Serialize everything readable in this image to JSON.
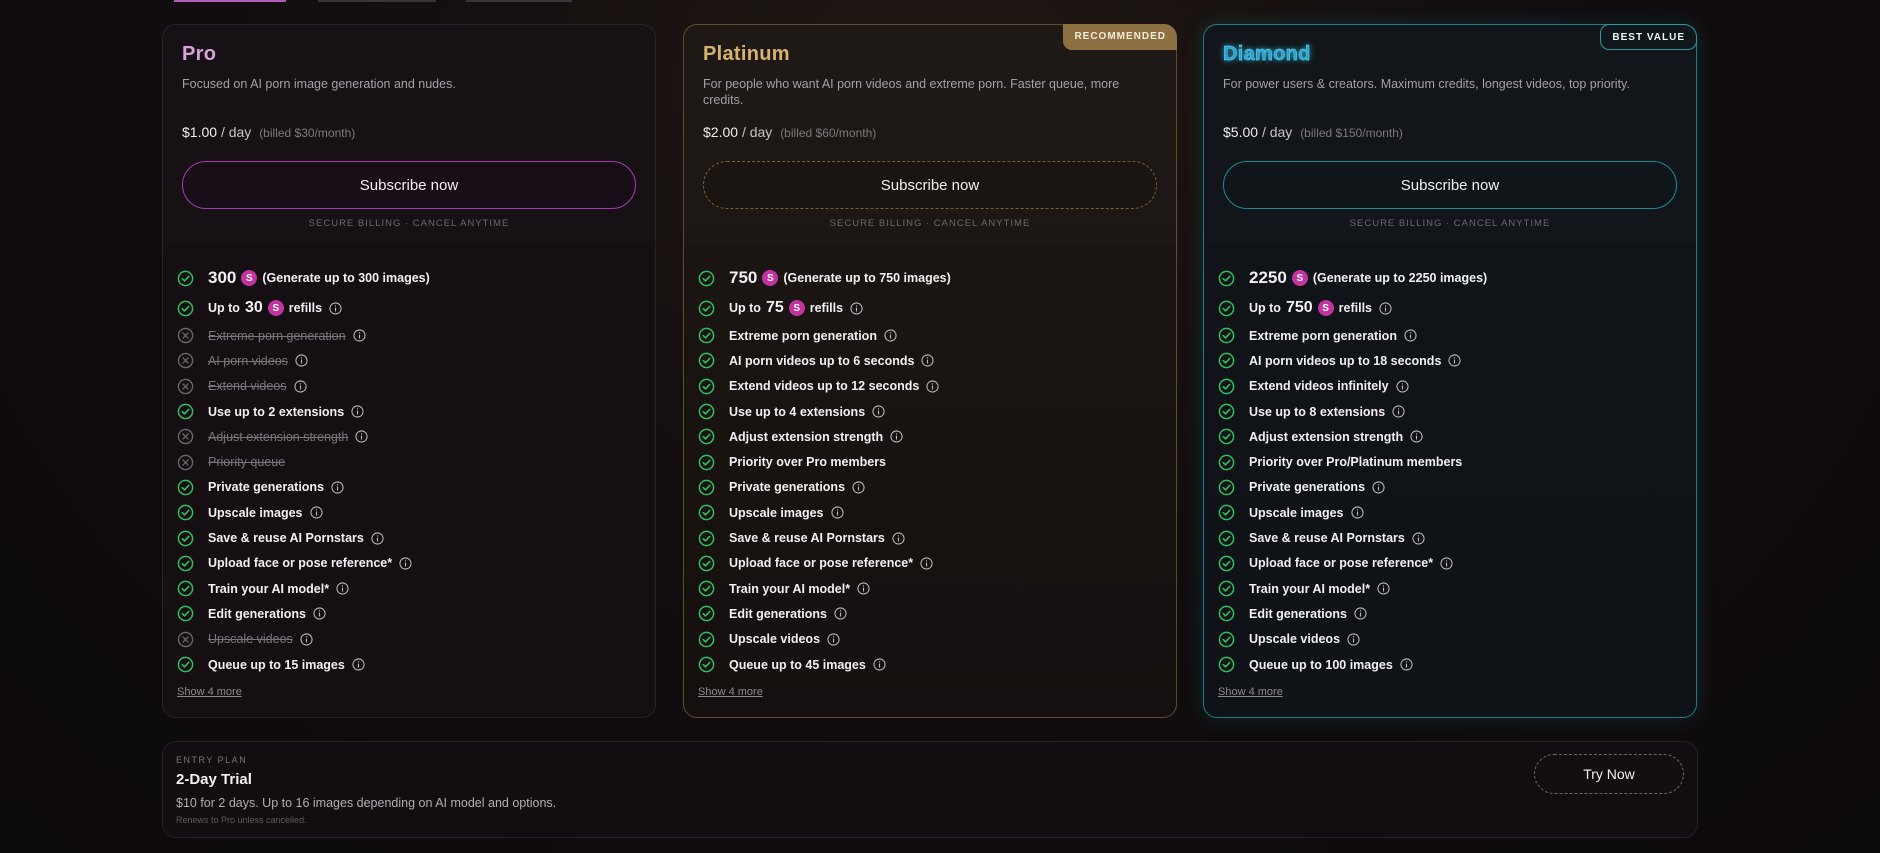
{
  "plans": [
    {
      "name": "Pro",
      "description": "Focused on AI porn image generation and nudes.",
      "price": "$1.00",
      "per": "/ day",
      "billed": "(billed $30/month)",
      "cta": "Subscribe now",
      "secure": "SECURE BILLING · CANCEL ANYTIME",
      "credits": {
        "amount": "300",
        "icon": "S",
        "text": "(Generate up to 300 images)"
      },
      "refills": {
        "prefix": "Up to",
        "amount": "30",
        "icon": "S",
        "suffix": "refills"
      },
      "features": [
        {
          "label": "Extreme porn generation",
          "included": false,
          "info": true
        },
        {
          "label": "AI porn videos",
          "included": false,
          "info": true
        },
        {
          "label": "Extend videos",
          "included": false,
          "info": true
        },
        {
          "label": "Use up to 2 extensions",
          "included": true,
          "info": true
        },
        {
          "label": "Adjust extension strength",
          "included": false,
          "info": true
        },
        {
          "label": "Priority queue",
          "included": false,
          "info": false
        },
        {
          "label": "Private generations",
          "included": true,
          "info": true
        },
        {
          "label": "Upscale images",
          "included": true,
          "info": true
        },
        {
          "label": "Save & reuse AI Pornstars",
          "included": true,
          "info": true
        },
        {
          "label": "Upload face or pose reference*",
          "included": true,
          "info": true
        },
        {
          "label": "Train your AI model*",
          "included": true,
          "info": true
        },
        {
          "label": "Edit generations",
          "included": true,
          "info": true
        },
        {
          "label": "Upscale videos",
          "included": false,
          "info": true
        },
        {
          "label": "Queue up to 15 images",
          "included": true,
          "info": true
        }
      ],
      "show_more": "Show 4 more"
    },
    {
      "name": "Platinum",
      "badge": "RECOMMENDED",
      "description": "For people who want AI porn videos and extreme porn. Faster queue, more credits.",
      "price": "$2.00",
      "per": "/ day",
      "billed": "(billed $60/month)",
      "cta": "Subscribe now",
      "secure": "SECURE BILLING · CANCEL ANYTIME",
      "credits": {
        "amount": "750",
        "icon": "S",
        "text": "(Generate up to 750 images)"
      },
      "refills": {
        "prefix": "Up to",
        "amount": "75",
        "icon": "S",
        "suffix": "refills"
      },
      "features": [
        {
          "label": "Extreme porn generation",
          "included": true,
          "info": true
        },
        {
          "label": "AI porn videos up to 6 seconds",
          "included": true,
          "info": true
        },
        {
          "label": "Extend videos up to 12 seconds",
          "included": true,
          "info": true
        },
        {
          "label": "Use up to 4 extensions",
          "included": true,
          "info": true
        },
        {
          "label": "Adjust extension strength",
          "included": true,
          "info": true
        },
        {
          "label": "Priority over Pro members",
          "included": true,
          "info": false
        },
        {
          "label": "Private generations",
          "included": true,
          "info": true
        },
        {
          "label": "Upscale images",
          "included": true,
          "info": true
        },
        {
          "label": "Save & reuse AI Pornstars",
          "included": true,
          "info": true
        },
        {
          "label": "Upload face or pose reference*",
          "included": true,
          "info": true
        },
        {
          "label": "Train your AI model*",
          "included": true,
          "info": true
        },
        {
          "label": "Edit generations",
          "included": true,
          "info": true
        },
        {
          "label": "Upscale videos",
          "included": true,
          "info": true
        },
        {
          "label": "Queue up to 45 images",
          "included": true,
          "info": true
        }
      ],
      "show_more": "Show 4 more"
    },
    {
      "name": "Diamond",
      "badge": "BEST VALUE",
      "description": "For power users & creators. Maximum credits, longest videos, top priority.",
      "price": "$5.00",
      "per": "/ day",
      "billed": "(billed $150/month)",
      "cta": "Subscribe now",
      "secure": "SECURE BILLING · CANCEL ANYTIME",
      "credits": {
        "amount": "2250",
        "icon": "S",
        "text": "(Generate up to 2250 images)"
      },
      "refills": {
        "prefix": "Up to",
        "amount": "750",
        "icon": "S",
        "suffix": "refills"
      },
      "features": [
        {
          "label": "Extreme porn generation",
          "included": true,
          "info": true
        },
        {
          "label": "AI porn videos up to 18 seconds",
          "included": true,
          "info": true
        },
        {
          "label": "Extend videos infinitely",
          "included": true,
          "info": true
        },
        {
          "label": "Use up to 8 extensions",
          "included": true,
          "info": true
        },
        {
          "label": "Adjust extension strength",
          "included": true,
          "info": true
        },
        {
          "label": "Priority over Pro/Platinum members",
          "included": true,
          "info": false
        },
        {
          "label": "Private generations",
          "included": true,
          "info": true
        },
        {
          "label": "Upscale images",
          "included": true,
          "info": true
        },
        {
          "label": "Save & reuse AI Pornstars",
          "included": true,
          "info": true
        },
        {
          "label": "Upload face or pose reference*",
          "included": true,
          "info": true
        },
        {
          "label": "Train your AI model*",
          "included": true,
          "info": true
        },
        {
          "label": "Edit generations",
          "included": true,
          "info": true
        },
        {
          "label": "Upscale videos",
          "included": true,
          "info": true
        },
        {
          "label": "Queue up to 100 images",
          "included": true,
          "info": true
        }
      ],
      "show_more": "Show 4 more"
    }
  ],
  "trial": {
    "eyebrow": "ENTRY PLAN",
    "title": "2-Day Trial",
    "description": "$10 for 2 days. Up to 16 images depending on AI model and options.",
    "note": "Renews to Pro unless cancelled.",
    "cta": "Try Now"
  },
  "colors": {
    "check": "#2fbf5e",
    "cross": "#6e676f",
    "credit": "#c2339e",
    "pro_accent": "#a23eb0",
    "platinum_accent": "#8d7040",
    "diamond_accent": "#1f9ba3"
  },
  "icons": {
    "included": "check-circle-icon",
    "excluded": "x-circle-icon",
    "info": "info-icon",
    "credit": "credit-coin-icon"
  }
}
